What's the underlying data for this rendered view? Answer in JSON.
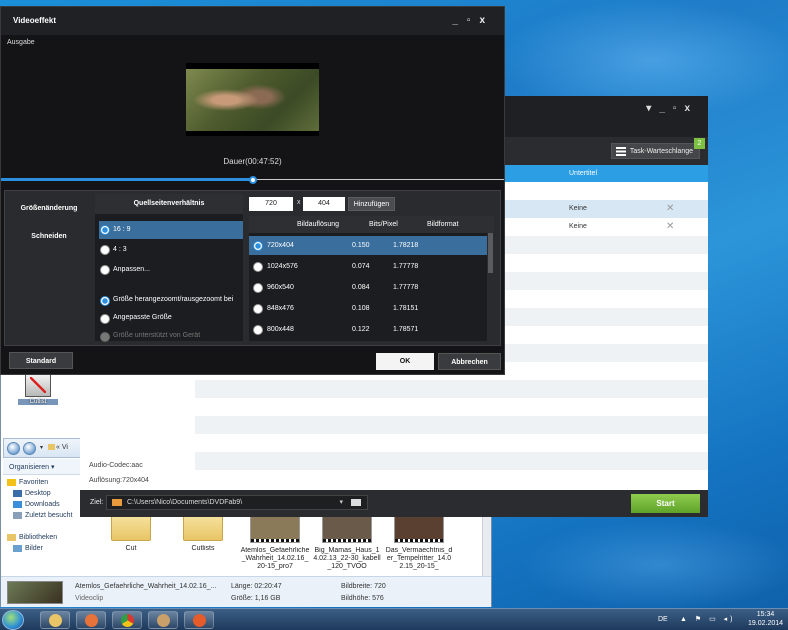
{
  "taskbar": {
    "language": "DE",
    "tray_icons": "▲ ⚑ ▭ ◂)",
    "time": "15:34",
    "date": "19.02.2014"
  },
  "explorer": {
    "nav_crumb": "« Vi",
    "organize": "Organisieren ▾",
    "sidebar": [
      {
        "label": "Favoriten",
        "icon": "star-icon",
        "sub": false
      },
      {
        "label": "Desktop",
        "icon": "desktop-icon",
        "sub": true
      },
      {
        "label": "Downloads",
        "icon": "downloads-icon",
        "sub": true
      },
      {
        "label": "Zuletzt besucht",
        "icon": "recent-icon",
        "sub": true
      },
      {
        "label": "",
        "icon": "",
        "sub": false
      },
      {
        "label": "Bibliotheken",
        "icon": "library-icon",
        "sub": false
      },
      {
        "label": "Bilder",
        "icon": "pictures-icon",
        "sub": true
      }
    ],
    "files": [
      {
        "name": "Cut",
        "kind": "folder"
      },
      {
        "name": "Cutlists",
        "kind": "folder"
      },
      {
        "name": "Atemlos_Gefaehrliche_Wahrheit_14.02.16_20-15_pro7",
        "kind": "video"
      },
      {
        "name": "Big_Mamas_Haus_14.02.13_22-30_kabell_120_TVOO",
        "kind": "video"
      },
      {
        "name": "Das_Vermaechtnis_der_Tempelritter_14.02.15_20-15_",
        "kind": "video"
      }
    ],
    "status": {
      "filename": "Atemlos_Gefaehrliche_Wahrheit_14.02.16_...",
      "type": "Videoclip",
      "length": "Länge: 02:20:47",
      "size": "Größe: 1,16 GB",
      "width": "Bildbreite: 720",
      "height": "Bildhöhe: 576"
    }
  },
  "desktop_icon": {
    "label": "Cutlist"
  },
  "dvdfab": {
    "queue_label": "Task-Warteschlange",
    "queue_count": "2",
    "header_col": "Untertitel",
    "rows": [
      {
        "subtitle": "Keine"
      },
      {
        "subtitle": "Keine"
      }
    ],
    "info": [
      "Audio-Codec:aac",
      "Auflösung:720x404"
    ],
    "dest_label": "Ziel:",
    "dest_path": "C:\\Users\\Nico\\Documents\\DVDFab9\\",
    "start_label": "Start"
  },
  "dialog": {
    "title": "Videoeffekt",
    "output_label": "Ausgabe",
    "duration": "Dauer(00:47:52)",
    "progress": 0.5,
    "tabs": [
      "Größenänderung",
      "Schneiden"
    ],
    "aspect_header": "Quellseitenverhältnis",
    "aspect_options": [
      "16 : 9",
      "4 : 3",
      "Anpassen..."
    ],
    "scale_options": [
      "Größe herangezoomt/rausgezoomt bei",
      "Angepasste Größe",
      "Größe unterstützt von Gerät"
    ],
    "width_value": "720",
    "times": "x",
    "height_value": "404",
    "add_label": "Hinzufügen",
    "table_headers": [
      "Bildauflösung",
      "Bits/Pixel",
      "Bildformat"
    ],
    "table_rows": [
      {
        "res": "720x404",
        "bits": "0.150",
        "fmt": "1.78218"
      },
      {
        "res": "1024x576",
        "bits": "0.074",
        "fmt": "1.77778"
      },
      {
        "res": "960x540",
        "bits": "0.084",
        "fmt": "1.77778"
      },
      {
        "res": "848x476",
        "bits": "0.108",
        "fmt": "1.78151"
      },
      {
        "res": "800x448",
        "bits": "0.122",
        "fmt": "1.78571"
      }
    ],
    "standard_label": "Standard",
    "ok_label": "OK",
    "cancel_label": "Abbrechen",
    "colors": {
      "accent": "#2d8fe0",
      "selected": "#3a6e9c"
    }
  }
}
